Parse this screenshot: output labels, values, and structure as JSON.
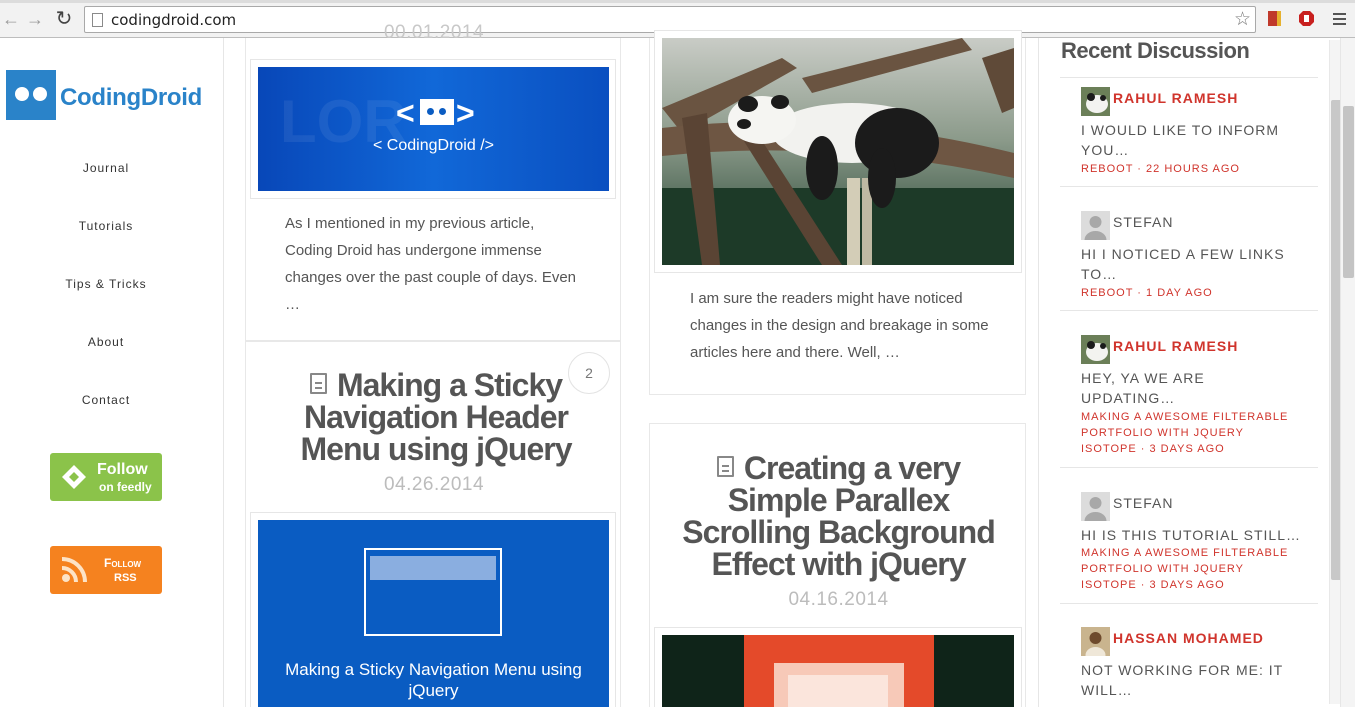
{
  "browser": {
    "url": "codingdroid.com"
  },
  "site": {
    "logo_text": "CodingDroid",
    "brand_color": "#2a83c9",
    "menu": [
      "Journal",
      "Tutorials",
      "Tips & Tricks",
      "About",
      "Contact"
    ],
    "feedly_badge": {
      "line1": "Follow",
      "line2": "on feedly"
    },
    "rss_badge": {
      "line1": "Follow",
      "line2": "RSS"
    }
  },
  "posts": {
    "top_date_partial": "00.01.2014",
    "coding_droid_banner": "< CodingDroid />",
    "excerpt_left": "As I mentioned in my previous article, Coding Droid has undergone immense changes over the past couple of days. Even …",
    "excerpt_right": "I am sure the readers might have noticed changes in the design and breakage in some articles here and there. Well, …",
    "sticky": {
      "title": "Making a Sticky Navigation Header Menu using jQuery",
      "date": "04.26.2014",
      "comments": "2",
      "thumb_caption": "Making a Sticky Navigation Menu using jQuery"
    },
    "parallax": {
      "title": "Creating a very Simple Parallex Scrolling Background Effect with jQuery",
      "date": "04.16.2014"
    }
  },
  "recent": {
    "title": "Recent Discussion",
    "items": [
      {
        "author": "RAHUL RAMESH",
        "text": "I WOULD LIKE TO INFORM YOU…",
        "meta": "REBOOT · 22 HOURS AGO",
        "avatar": "panda-avatar",
        "highlight": true
      },
      {
        "author": "STEFAN",
        "text": "HI I NOTICED A FEW LINKS TO…",
        "meta": "REBOOT · 1 DAY AGO",
        "avatar": "default-avatar",
        "highlight": false
      },
      {
        "author": "RAHUL RAMESH",
        "text": "HEY, YA WE ARE UPDATING…",
        "meta": "MAKING A AWESOME FILTERABLE PORTFOLIO WITH JQUERY ISOTOPE · 3 DAYS AGO",
        "avatar": "panda-avatar",
        "highlight": true
      },
      {
        "author": "STEFAN",
        "text": "HI IS THIS TUTORIAL STILL…",
        "meta": "MAKING A AWESOME FILTERABLE PORTFOLIO WITH JQUERY ISOTOPE · 3 DAYS AGO",
        "avatar": "default-avatar",
        "highlight": false
      },
      {
        "author": "HASSAN MOHAMED",
        "text": "NOT WORKING FOR ME: IT WILL…",
        "meta": "",
        "avatar": "person-avatar",
        "highlight": true
      }
    ]
  },
  "colors": {
    "accent_red": "#d0342c",
    "feedly_green": "#8bc34a",
    "rss_orange": "#f5821f",
    "thumb_blue": "#0a5cc2"
  }
}
